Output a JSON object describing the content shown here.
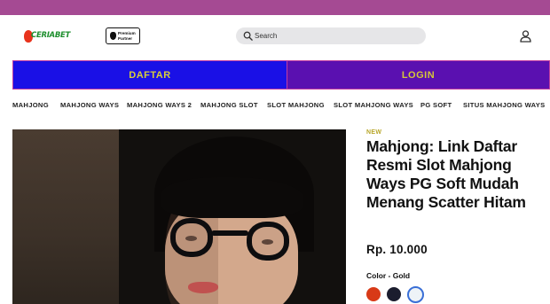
{
  "brand": {
    "logo_text": "CERIABET",
    "partner_badge": "Premium Partner"
  },
  "search": {
    "placeholder": "Search"
  },
  "buttons": {
    "daftar": "DAFTAR",
    "login": "LOGIN"
  },
  "nav": {
    "items": [
      "MAHJONG",
      "MAHJONG WAYS",
      "MAHJONG WAYS 2",
      "MAHJONG SLOT",
      "SLOT MAHJONG",
      "SLOT MAHJONG WAYS",
      "PG SOFT",
      "SITUS MAHJONG WAYS"
    ]
  },
  "product": {
    "badge": "NEW",
    "title": "Mahjong: Link Daftar Resmi Slot Mahjong Ways PG Soft Mudah Menang Scatter Hitam",
    "price": "Rp. 10.000",
    "color_label": "Color - Gold",
    "swatches": [
      {
        "name": "red",
        "color": "#d83a17",
        "selected": false
      },
      {
        "name": "navy",
        "color": "#1b1d2e",
        "selected": false
      },
      {
        "name": "white",
        "color": "#eef3f7",
        "selected": true
      }
    ]
  },
  "colors": {
    "top_bar": "#a54a93",
    "daftar_bg": "#1a10e6",
    "login_bg": "#5a10b0",
    "button_text": "#d8cf3a",
    "button_border": "#c23ea0",
    "badge": "#b8a62a"
  },
  "icons": [
    "logo-flame-icon",
    "apple-icon",
    "search-icon",
    "user-icon"
  ]
}
